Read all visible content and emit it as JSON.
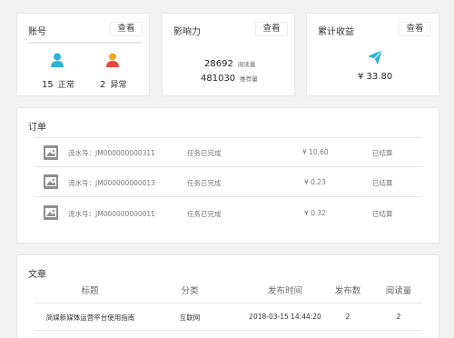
{
  "account": {
    "title": "账号",
    "view_label": "查看",
    "normal": {
      "count": "15",
      "label": "正常"
    },
    "abnormal": {
      "count": "2",
      "label": "异常"
    }
  },
  "influence": {
    "title": "影响力",
    "view_label": "查看",
    "reads": {
      "value": "28692",
      "unit": "阅读量"
    },
    "recommends": {
      "value": "481030",
      "unit": "推荐量"
    }
  },
  "earnings": {
    "title": "累计收益",
    "view_label": "查看",
    "amount": "¥ 33.80"
  },
  "orders": {
    "title": "订单",
    "rows": [
      {
        "serial": "流水号：JM000000000311",
        "task": "任务已完成",
        "amount": "¥ 10.60",
        "status": "已结算"
      },
      {
        "serial": "流水号：JM000000000013",
        "task": "任务已完成",
        "amount": "¥ 0.23",
        "status": "已结算"
      },
      {
        "serial": "流水号：JM000000000011",
        "task": "任务已完成",
        "amount": "¥ 0.32",
        "status": "已结算"
      }
    ]
  },
  "articles": {
    "title": "文章",
    "columns": [
      "标题",
      "分类",
      "发布时间",
      "发布数",
      "阅读量"
    ],
    "rows": [
      {
        "title": "简媒新媒体运营平台使用指南",
        "category": "互联网",
        "published": "2018-03-15 14:44:20",
        "publish_count": "2",
        "reads": "2"
      }
    ]
  },
  "colors": {
    "normal_icon": "#29b6d6",
    "abnormal_icon": "#e84a3c",
    "abnormal_icon_top": "#f2a42c",
    "plane_icon": "#2bb3d6",
    "order_icon": "#8d8d8d"
  }
}
